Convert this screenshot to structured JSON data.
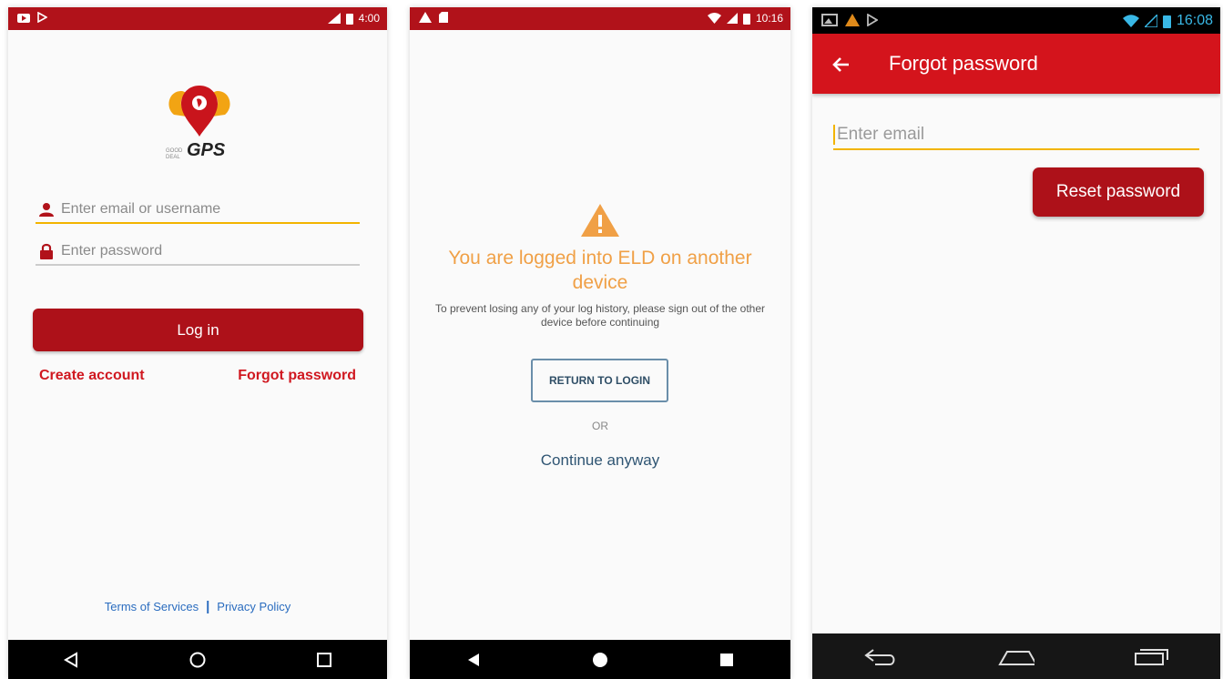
{
  "colors": {
    "brand_red": "#ad1119",
    "toolbar_red": "#d4141c",
    "warning_orange": "#f0a046",
    "link_blue": "#2a6cbf",
    "accent_yellow": "#f2b400"
  },
  "screen_login": {
    "status_time": "4:00",
    "status_left_icons": [
      "youtube-icon",
      "play-store-icon"
    ],
    "status_right_icons": [
      "signal-icon",
      "battery-icon"
    ],
    "logo_small_text": "GOOD DEAL",
    "logo_text": "GPS",
    "username_placeholder": "Enter email or username",
    "password_placeholder": "Enter password",
    "login_label": "Log in",
    "create_account_label": "Create account",
    "forgot_password_label": "Forgot password",
    "terms_label": "Terms of Services",
    "separator": "|",
    "privacy_label": "Privacy Policy",
    "nav": [
      "back-icon",
      "home-icon",
      "recents-icon"
    ]
  },
  "screen_eld": {
    "status_time": "10:16",
    "title": "You are logged into ELD on another device",
    "subtitle": "To prevent losing any of your log history, please sign out of the other device before continuing",
    "return_label": "RETURN TO LOGIN",
    "or_label": "OR",
    "continue_label": "Continue anyway"
  },
  "screen_forgot": {
    "status_time": "16:08",
    "toolbar_title": "Forgot password",
    "email_placeholder": "Enter email",
    "reset_label": "Reset password"
  }
}
